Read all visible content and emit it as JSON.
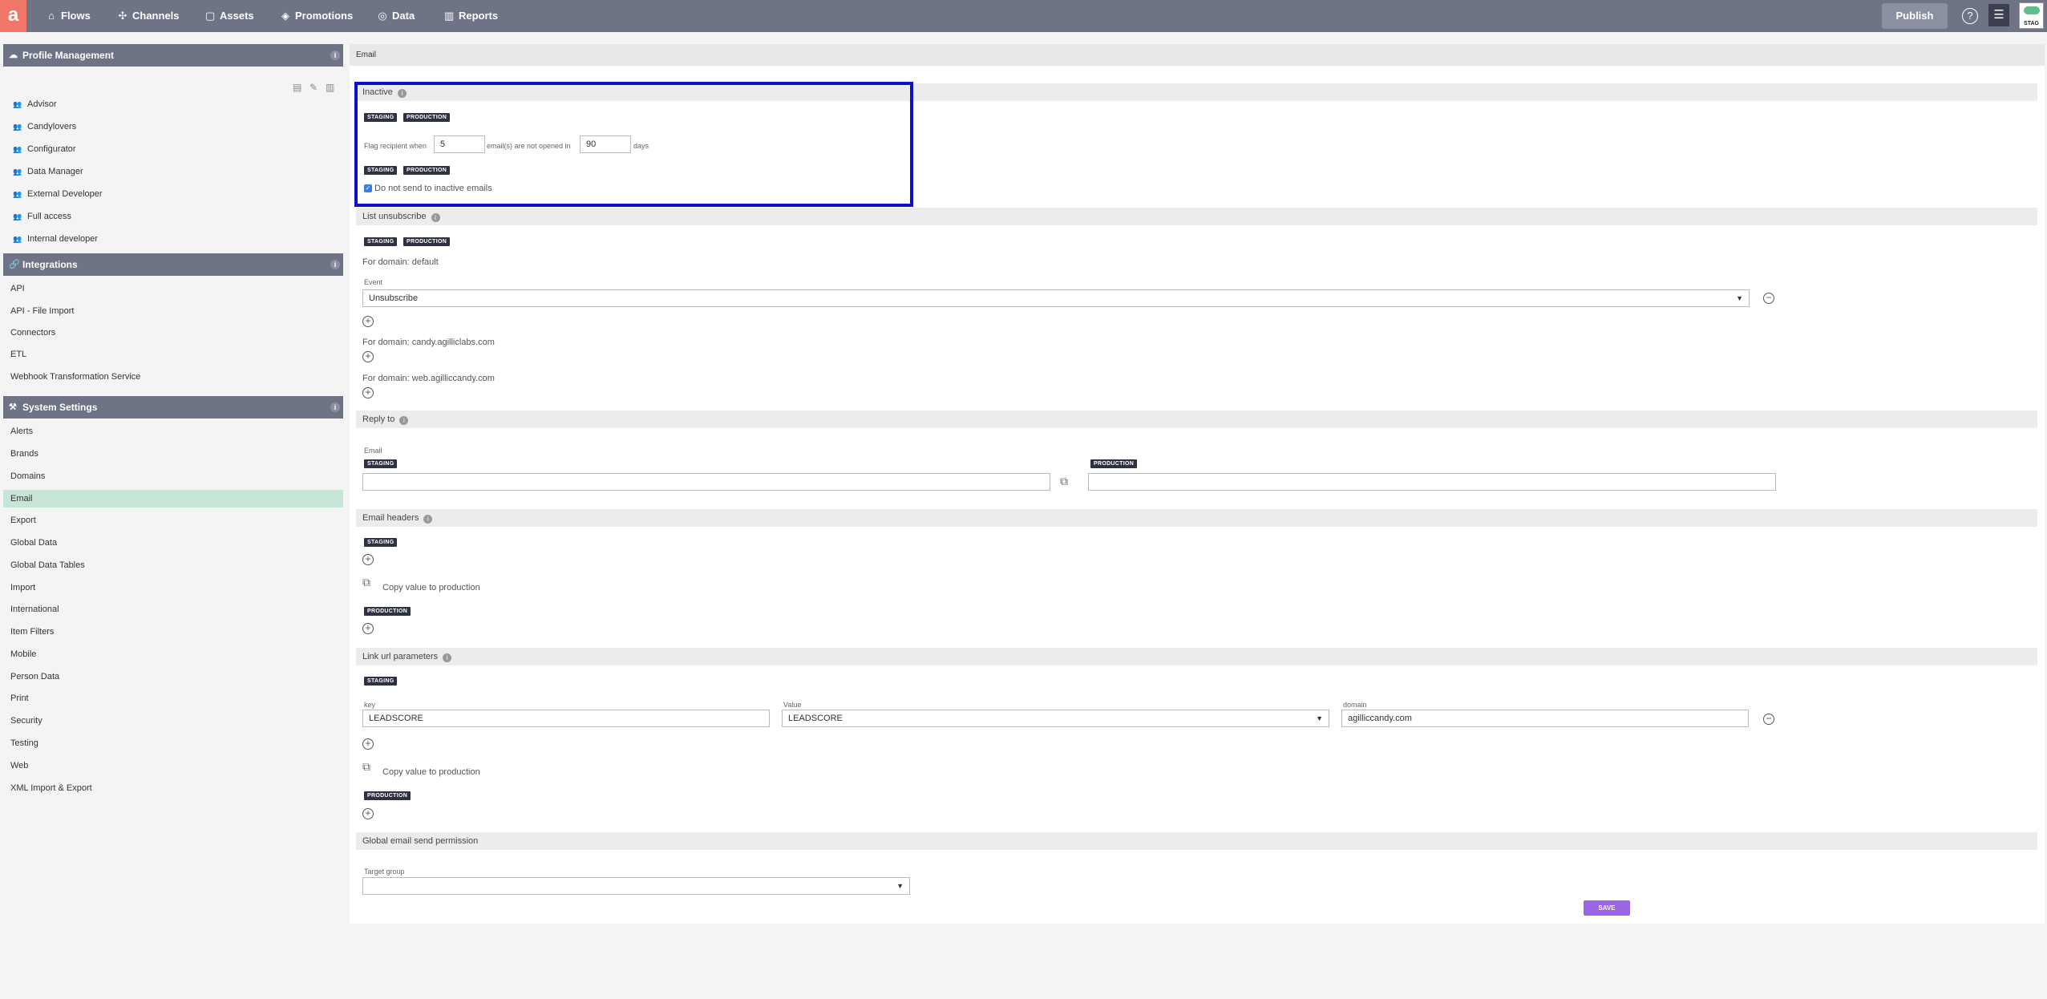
{
  "nav": {
    "logo": "a",
    "items": [
      {
        "label": "Flows",
        "icon": "flows-icon"
      },
      {
        "label": "Channels",
        "icon": "channels-icon"
      },
      {
        "label": "Assets",
        "icon": "assets-icon"
      },
      {
        "label": "Promotions",
        "icon": "promotions-icon"
      },
      {
        "label": "Data",
        "icon": "data-icon"
      },
      {
        "label": "Reports",
        "icon": "reports-icon"
      }
    ],
    "publish": "Publish",
    "help": "?",
    "env_label": "STAG"
  },
  "sidebar": {
    "profile_management": {
      "title": "Profile Management",
      "items": [
        "Advisor",
        "Candylovers",
        "Configurator",
        "Data Manager",
        "External Developer",
        "Full access",
        "Internal developer"
      ]
    },
    "integrations": {
      "title": "Integrations",
      "items": [
        "API",
        "API - File Import",
        "Connectors",
        "ETL",
        "Webhook Transformation Service"
      ]
    },
    "system_settings": {
      "title": "System Settings",
      "items": [
        "Alerts",
        "Brands",
        "Domains",
        "Email",
        "Export",
        "Global Data",
        "Global Data Tables",
        "Import",
        "International",
        "Item Filters",
        "Mobile",
        "Person Data",
        "Print",
        "Security",
        "Testing",
        "Web",
        "XML Import & Export"
      ],
      "active": "Email"
    }
  },
  "main": {
    "breadcrumb": "Email",
    "tags": {
      "staging": "STAGING",
      "production": "PRODUCTION"
    },
    "inactive": {
      "title": "Inactive",
      "flag_prefix": "Flag recipient when",
      "emails_value": "5",
      "middle": "email(s) are not opened in",
      "days_value": "90",
      "suffix": "days",
      "checkbox_label": "Do not send to inactive emails",
      "checked": true
    },
    "list_unsubscribe": {
      "title": "List unsubscribe",
      "domain_default": "For domain: default",
      "event_label": "Event",
      "event_value": "Unsubscribe",
      "domain_candy": "For domain: candy.agilliclabs.com",
      "domain_web": "For domain: web.agilliccandy.com"
    },
    "reply_to": {
      "title": "Reply to",
      "email_label": "Email",
      "staging_value": "",
      "production_value": ""
    },
    "email_headers": {
      "title": "Email headers",
      "copy_label": "Copy value to production"
    },
    "link_url": {
      "title": "Link url parameters",
      "key_label": "key",
      "value_label": "Value",
      "domain_label": "domain",
      "key_value": "LEADSCORE",
      "value_value": "LEADSCORE",
      "domain_value": "agilliccandy.com",
      "copy_label": "Copy value to production"
    },
    "global_permission": {
      "title": "Global email send permission",
      "target_label": "Target group",
      "target_value": ""
    },
    "save": "SAVE"
  }
}
